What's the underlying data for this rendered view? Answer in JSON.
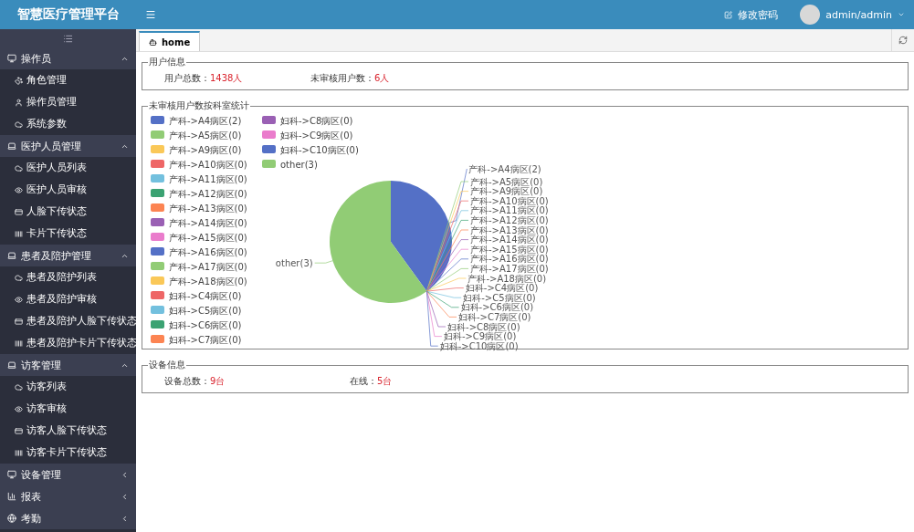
{
  "app_title": "智慧医疗管理平台",
  "header": {
    "change_password": "修改密码",
    "user": "admin/admin"
  },
  "sidebar": {
    "groups": [
      {
        "label": "操作员",
        "expanded": true,
        "children": [
          {
            "label": "角色管理"
          },
          {
            "label": "操作员管理"
          },
          {
            "label": "系统参数"
          }
        ]
      },
      {
        "label": "医护人员管理",
        "expanded": true,
        "children": [
          {
            "label": "医护人员列表"
          },
          {
            "label": "医护人员审核"
          },
          {
            "label": "人脸下传状态"
          },
          {
            "label": "卡片下传状态"
          }
        ]
      },
      {
        "label": "患者及陪护管理",
        "expanded": true,
        "children": [
          {
            "label": "患者及陪护列表"
          },
          {
            "label": "患者及陪护审核"
          },
          {
            "label": "患者及陪护人脸下传状态"
          },
          {
            "label": "患者及陪护卡片下传状态"
          }
        ]
      },
      {
        "label": "访客管理",
        "expanded": true,
        "children": [
          {
            "label": "访客列表"
          },
          {
            "label": "访客审核"
          },
          {
            "label": "访客人脸下传状态"
          },
          {
            "label": "访客卡片下传状态"
          }
        ]
      },
      {
        "label": "设备管理",
        "expanded": false
      },
      {
        "label": "报表",
        "expanded": false
      },
      {
        "label": "考勤",
        "expanded": false
      }
    ]
  },
  "tabs": [
    {
      "label": "home",
      "selected": true
    }
  ],
  "user_info": {
    "title": "用户信息",
    "items": [
      {
        "label": "用户总数：",
        "value": "1438人"
      },
      {
        "label": "未审核用户数：",
        "value": "6人"
      }
    ]
  },
  "chart_panel": {
    "title": "未审核用户数按科室统计",
    "chart_data": {
      "type": "pie",
      "categories": [
        "产科->A4病区(2)",
        "产科->A5病区(0)",
        "产科->A9病区(0)",
        "产科->A10病区(0)",
        "产科->A11病区(0)",
        "产科->A12病区(0)",
        "产科->A13病区(0)",
        "产科->A14病区(0)",
        "产科->A15病区(0)",
        "产科->A16病区(0)",
        "产科->A17病区(0)",
        "产科->A18病区(0)",
        "妇科->C4病区(0)",
        "妇科->C5病区(0)",
        "妇科->C6病区(0)",
        "妇科->C7病区(0)",
        "妇科->C8病区(0)",
        "妇科->C9病区(0)",
        "妇科->C10病区(0)",
        "other(3)"
      ],
      "values": [
        2,
        0,
        0,
        0,
        0,
        0,
        0,
        0,
        0,
        0,
        0,
        0,
        0,
        0,
        0,
        0,
        0,
        0,
        0,
        3
      ],
      "colors": [
        "#5470c6",
        "#91cc75",
        "#fac858",
        "#ee6666",
        "#73c0de",
        "#3ba272",
        "#fc8452",
        "#9a60b4",
        "#ea7ccc",
        "#5470c6",
        "#91cc75",
        "#fac858",
        "#ee6666",
        "#73c0de",
        "#3ba272",
        "#fc8452",
        "#9a60b4",
        "#ea7ccc",
        "#5470c6",
        "#91cc75"
      ],
      "legend": "top-left"
    }
  },
  "device_info": {
    "title": "设备信息",
    "items": [
      {
        "label": "设备总数：",
        "value": "9台"
      },
      {
        "label": "在线：",
        "value": "5台"
      }
    ]
  }
}
